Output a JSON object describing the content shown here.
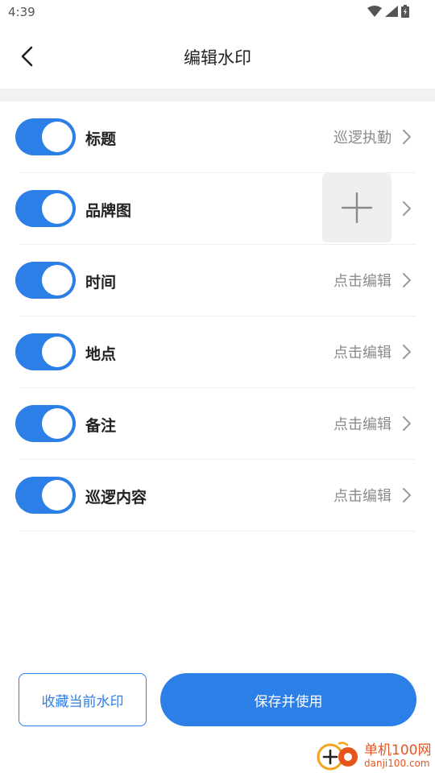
{
  "status_bar": {
    "time": "4:39"
  },
  "header": {
    "title": "编辑水印"
  },
  "rows": [
    {
      "label": "标题",
      "value": "巡逻执勤",
      "enabled": true
    },
    {
      "label": "品牌图",
      "value": "",
      "enabled": true
    },
    {
      "label": "时间",
      "value": "点击编辑",
      "enabled": true
    },
    {
      "label": "地点",
      "value": "点击编辑",
      "enabled": true
    },
    {
      "label": "备注",
      "value": "点击编辑",
      "enabled": true
    },
    {
      "label": "巡逻内容",
      "value": "点击编辑",
      "enabled": true
    }
  ],
  "footer": {
    "collect_label": "收藏当前水印",
    "save_label": "保存并使用"
  },
  "watermark": {
    "brand": "单机100网",
    "url": "danji100.com"
  },
  "colors": {
    "accent": "#2b7fe6",
    "brand_orange": "#e8541e"
  }
}
